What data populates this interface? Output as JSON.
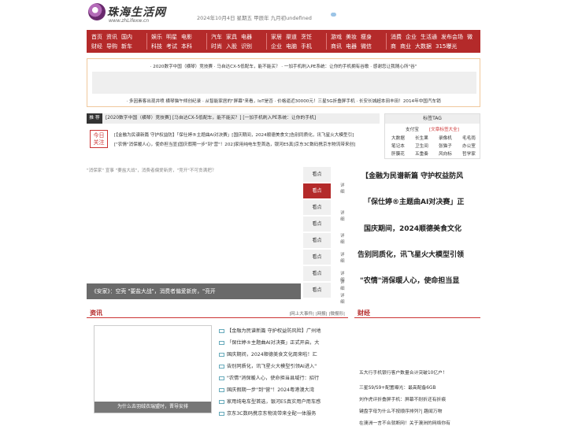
{
  "header": {
    "logo_name": "珠海生活网",
    "logo_url": "www.zhLifexw.cn",
    "date": "2024年10月4日 星期五  甲辰年 九月初undefined",
    "weather_a": "",
    "weather_b": ""
  },
  "nav": {
    "groups": [
      {
        "row1": [
          "首页",
          "资讯",
          "国内"
        ],
        "row2": [
          "财经",
          "导购",
          "新车"
        ]
      },
      {
        "row1": [
          "娱乐",
          "明星",
          "电影"
        ],
        "row2": [
          "科技",
          "考试",
          "本科"
        ]
      },
      {
        "row1": [
          "汽车",
          "家具",
          "电器"
        ],
        "row2": [
          "时尚",
          "入股",
          "识别"
        ]
      },
      {
        "row1": [
          "家居",
          "渠道",
          "烹饪"
        ],
        "row2": [
          "企业",
          "电脑",
          "手机"
        ]
      },
      {
        "row1": [
          "游戏",
          "美妆",
          "瘦身"
        ],
        "row2": [
          "商讯",
          "电器",
          "微信"
        ]
      },
      {
        "row1": [
          "消费",
          "企业",
          "生活通",
          "发布会场",
          "微"
        ],
        "row2": [
          "商",
          "商业",
          "大数据",
          "315曝光"
        ]
      }
    ]
  },
  "adbox": {
    "line1": "· 2020数字中国（横琴）竞技赛 · 马自达CX-5低配车，能不能买？ · 一加手机刷入PE系统：让你的手机拥有谷歌 · 感谢您让我随心所\"谷\"",
    "line2": "· 多因素客出现井喷 横琴猫午倾创纪录 · 从智能家居的\"屏幕\"来看，IoT是否 · 价格逼近30000元！三星5G折叠屏手机 · 长安长城超本田丰田！2014年中国汽车销"
  },
  "rec": {
    "tag": "推 荐",
    "text": "[2020数字中国（横琴）竞技赛]   [马自达CX-5低配车，能不能买？]   [一加手机刷入PE系统：让你的手机]"
  },
  "stamp": "今日 关注",
  "rec_lines": [
    "[【金融为民谱新篇 守护权益防】「保仕婷®主题曲AI对决赛」[国庆期间，2024顺德美食文]告别同质化，讯飞星火大模型引]",
    "[\"农情\"消保暖人心，使命担当显]国庆假期一步\"到\"营\"！202]家用纯电车型首选，银河E5真]京东3C数码携京东物流带来创]"
  ],
  "tagbox": {
    "title": "标签TAG",
    "rows": [
      [
        "支付宝",
        "[文章标签大全]"
      ],
      [
        "大数据",
        "长生果",
        "录像机",
        "毛毛雨"
      ],
      [
        "笔记本",
        "卫生间",
        "张猫子",
        "办公室"
      ],
      [
        "肝膜花",
        "五重奏",
        "风向标",
        "哲学家"
      ]
    ]
  },
  "bigimg": {
    "caption": "\"消保家\" 宣事 \"要盐大战\"，消费者偏爱新房，\"竞开\"不可贪满把？",
    "bar": "《安家》：空壳 \"要盐大战\"，消费者偏爱新房，\"竞开"
  },
  "tabs": [
    "看点",
    "看点",
    "看点",
    "看点",
    "看点",
    "看点",
    "看点",
    "看点"
  ],
  "xq": [
    "详细",
    "详细",
    "详细",
    "详细",
    "详细",
    "详细",
    "详细"
  ],
  "heads": [
    "【金融为民谱新篇 守护权益防风",
    "「保仕婷®主题曲AI对决赛」正",
    "国庆期间，2024顺德美食文化",
    "告别同质化，讯飞星火大模型引领",
    "\"农情\"消保暖人心，使命担当显"
  ],
  "news": {
    "title": "资讯",
    "links": "|网上大事件|  |网报|  |微报形|",
    "img_caption": "为什么去羽绒衣瑞盟时，晋导安排",
    "items": [
      "【金融为民谱新篇 守护权益防风险】广州地",
      "「保仕婷®主题曲AI对决赛」正式开启，大",
      "国庆期间，2024顺德美食文化周来啦！汇",
      "告别同质化，讯飞星火大模型引领AI进入\"",
      "\"农情\"消保暖人心，使命担当县域行：招行",
      "国庆假期一步\"到\"营\"！2024粤港澳大湾",
      "家用纯电车型首选，银河E5真实用户用车感",
      "京东3C数码携京东物流带来全配一体服务"
    ]
  },
  "finance": {
    "title": "财经",
    "items": [
      "五大行手机银行客户数量合计突破10亿户！",
      "三星S9/S9+配置曝光：最高配备6GB",
      "刘作虎评折叠屏手机：屏幕不耐折还有折痕",
      "键盘字母为什么不按顺序排列?| 趣闻万物",
      "在澳洲一言不合就断网！关于澳洲的网络你有"
    ]
  }
}
